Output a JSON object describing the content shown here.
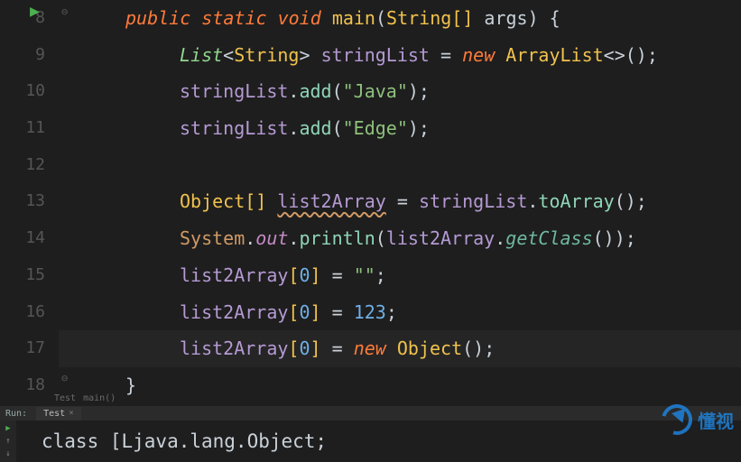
{
  "gutter": {
    "start": 8,
    "end": 18
  },
  "code": {
    "l8": {
      "kw_public": "public",
      "kw_static": "static",
      "kw_void": "void",
      "fn": "main",
      "type": "String",
      "brL": "[]",
      "par": "args",
      "paren": ") {"
    },
    "l9": {
      "gen": "List",
      "lt": "<",
      "type": "String",
      "gt": ">",
      "var": "stringList",
      "eq": "=",
      "kw_new": "new",
      "cls": "ArrayList",
      "diamond": "<>()",
      ";": ""
    },
    "l10": {
      "var": "stringList",
      "dot": ".",
      "mtd": "add",
      "open": "(",
      "str": "\"Java\"",
      "close": ");"
    },
    "l11": {
      "var": "stringList",
      "dot": ".",
      "mtd": "add",
      "open": "(",
      "str": "\"Edge\"",
      "close": ");"
    },
    "l12": {},
    "l13": {
      "type": "Object",
      "brL": "[]",
      "var": "list2Array",
      "eq": "=",
      "rhs": "stringList",
      "dot": ".",
      "mtd": "toArray",
      "close": "();"
    },
    "l14": {
      "cls": "System",
      "dot": ".",
      "fld": "out",
      "dot2": ".",
      "mtd": "println",
      "open": "(",
      "var": "list2Array",
      "dot3": ".",
      "mtd2": "getClass",
      "close": "());"
    },
    "l15": {
      "var": "list2Array",
      "i": "[",
      "n": "0",
      "c": "]",
      "eq": "=",
      "str": "\"\"",
      "sc": ";"
    },
    "l16": {
      "var": "list2Array",
      "i": "[",
      "n": "0",
      "c": "]",
      "eq": "=",
      "num": "123",
      "sc": ";"
    },
    "l17": {
      "var": "list2Array",
      "i": "[",
      "n": "0",
      "c": "]",
      "eq": "=",
      "kw_new": "new",
      "type": "Object",
      "close": "();"
    },
    "l18": {
      "brace": "}"
    }
  },
  "breadcrumb": {
    "a": "Test",
    "b": "main()"
  },
  "runrow": {
    "label": "Run:",
    "tab": "Test",
    "x": "×"
  },
  "sidebar": {
    "play": "▶",
    "up": "↑",
    "down": "↓"
  },
  "console": {
    "out": "class [Ljava.lang.Object;"
  },
  "watermark": {
    "text": "懂视"
  }
}
